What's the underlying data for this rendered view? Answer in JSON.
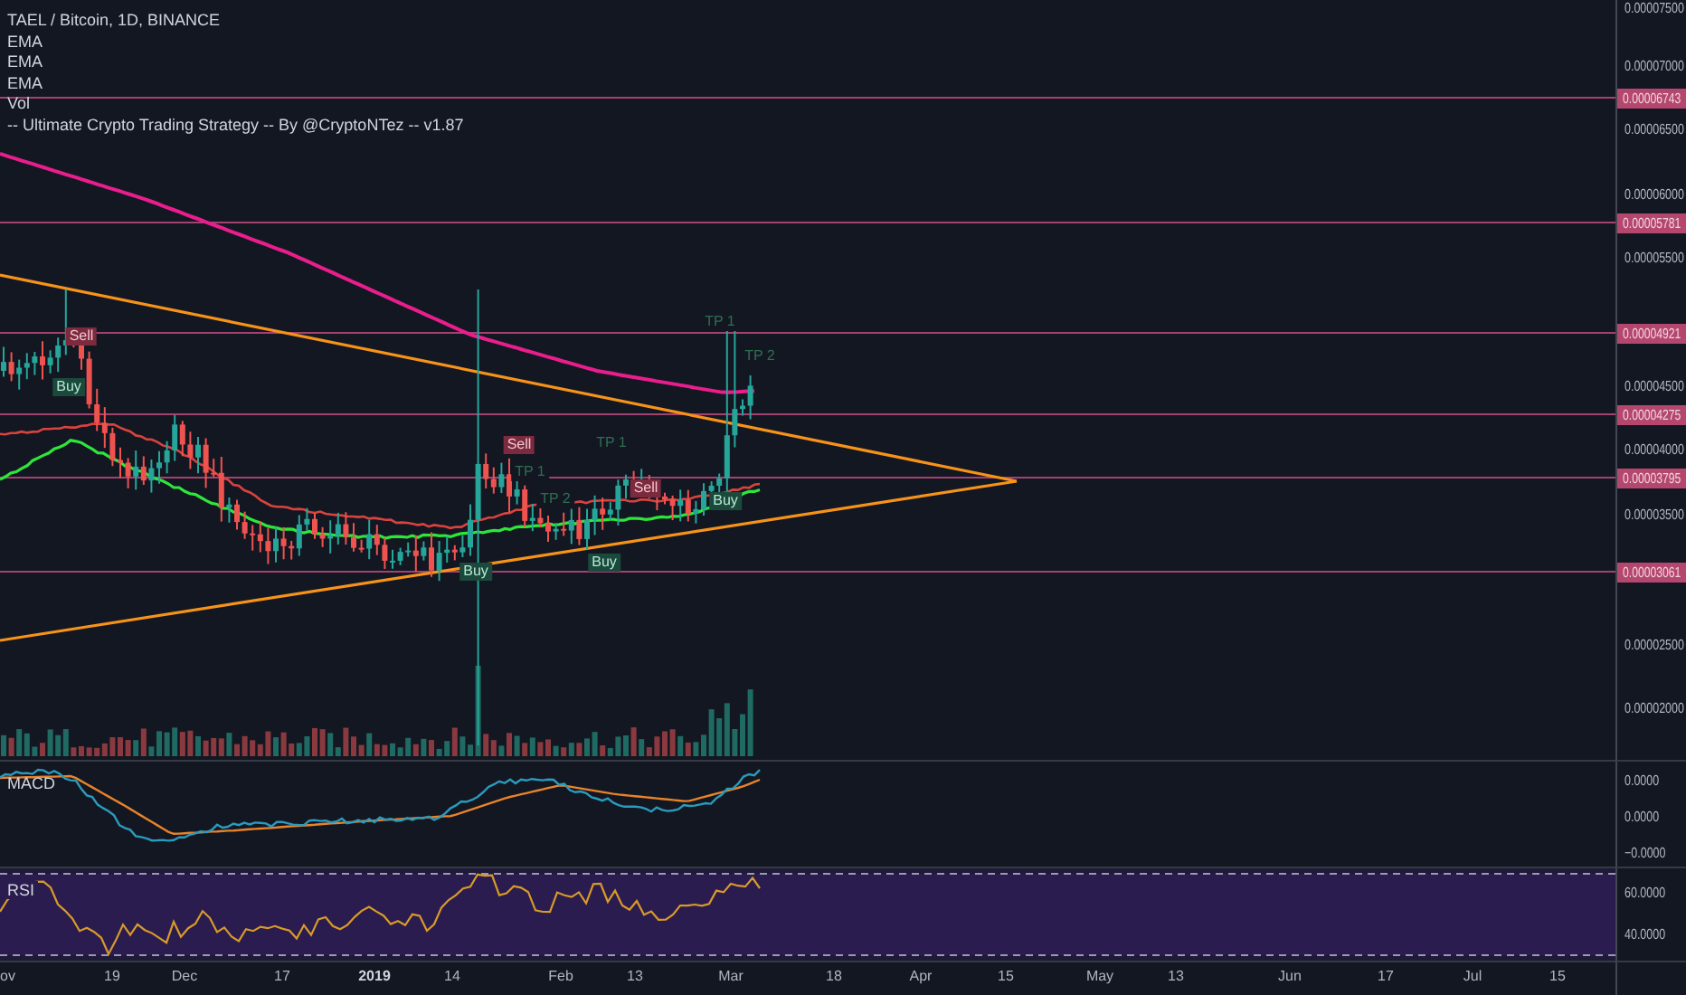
{
  "header": {
    "symbol": "TAEL / Bitcoin, 1D, BINANCE",
    "indicators": [
      "EMA",
      "EMA",
      "EMA",
      "Vol",
      "-- Ultimate Crypto Trading Strategy -- By @CryptoNTez -- v1.87"
    ]
  },
  "price_axis": {
    "ticks": [
      "0.00007500",
      "0.00007000",
      "0.00006500",
      "0.00006000",
      "0.00005500",
      "0.00004500",
      "0.00004000",
      "0.00003500",
      "0.00002500",
      "0.00002000"
    ],
    "levels": [
      {
        "label": "0.00006743"
      },
      {
        "label": "0.00005781"
      },
      {
        "label": "0.00004921"
      },
      {
        "label": "0.00004275"
      },
      {
        "label": "0.00003795"
      },
      {
        "label": "0.00003061"
      }
    ]
  },
  "signals": [
    {
      "kind": "sell",
      "label": "Sell"
    },
    {
      "kind": "buy",
      "label": "Buy"
    },
    {
      "kind": "sell",
      "label": "Sell"
    },
    {
      "kind": "sell",
      "label": "Sell"
    },
    {
      "kind": "buy",
      "label": "Buy"
    },
    {
      "kind": "buy",
      "label": "Buy"
    },
    {
      "kind": "buy",
      "label": "Buy"
    },
    {
      "kind": "target",
      "label": "TP 1"
    },
    {
      "kind": "target",
      "label": "TP 2"
    },
    {
      "kind": "target",
      "label": "TP 1"
    },
    {
      "kind": "target",
      "label": "TP 1"
    },
    {
      "kind": "target",
      "label": "TP 2"
    }
  ],
  "macd": {
    "title": "MACD",
    "ticks": [
      "0.0000",
      "0.0000",
      "−0.0000"
    ]
  },
  "rsi": {
    "title": "RSI",
    "ticks": [
      "60.0000",
      "40.0000"
    ]
  },
  "time_axis": [
    {
      "kind": "month",
      "label": "ov"
    },
    {
      "kind": "day",
      "label": "19"
    },
    {
      "kind": "month",
      "label": "Dec"
    },
    {
      "kind": "day",
      "label": "17"
    },
    {
      "kind": "year",
      "label": "2019"
    },
    {
      "kind": "day",
      "label": "14"
    },
    {
      "kind": "month",
      "label": "Feb"
    },
    {
      "kind": "day",
      "label": "13"
    },
    {
      "kind": "month",
      "label": "Mar"
    },
    {
      "kind": "day",
      "label": "18"
    },
    {
      "kind": "month",
      "label": "Apr"
    },
    {
      "kind": "day",
      "label": "15"
    },
    {
      "kind": "month",
      "label": "May"
    },
    {
      "kind": "day",
      "label": "13"
    },
    {
      "kind": "month",
      "label": "Jun"
    },
    {
      "kind": "day",
      "label": "17"
    },
    {
      "kind": "month",
      "label": "Jul"
    },
    {
      "kind": "day",
      "label": "15"
    }
  ]
}
